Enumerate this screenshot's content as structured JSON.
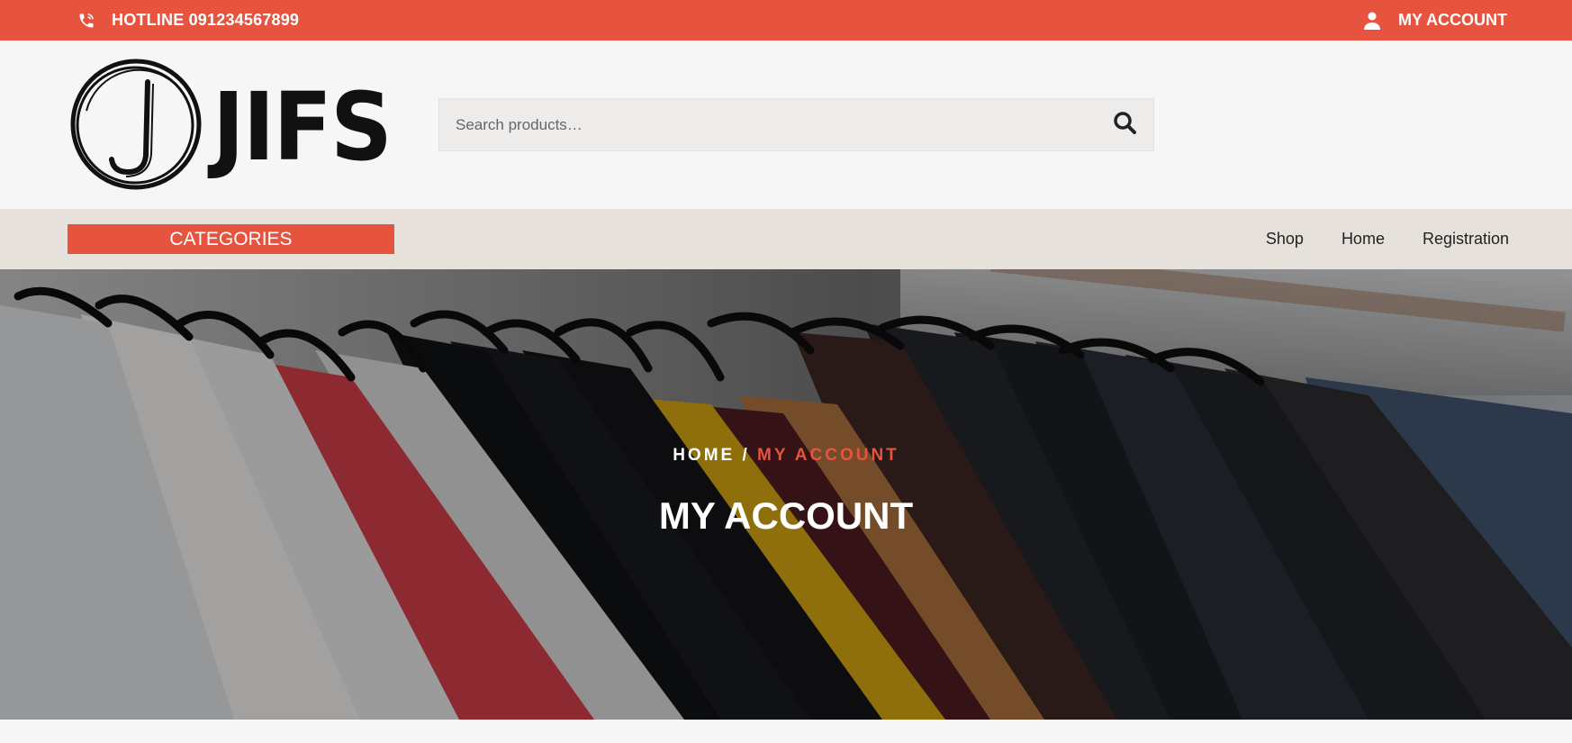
{
  "topbar": {
    "hotline": "HOTLINE 091234567899",
    "account": "MY ACCOUNT",
    "phone_icon": "phone-icon",
    "user_icon": "user-icon"
  },
  "header": {
    "logo_text": "JIFS",
    "search": {
      "placeholder": "Search products…",
      "value": ""
    }
  },
  "nav": {
    "categories": "CATEGORIES",
    "links": [
      "Shop",
      "Home",
      "Registration"
    ]
  },
  "hero": {
    "breadcrumb_home": "HOME",
    "breadcrumb_sep": "/",
    "breadcrumb_current": "MY ACCOUNT",
    "title": "MY ACCOUNT"
  },
  "colors": {
    "accent": "#e6533e",
    "nav_bg": "#e6e1da",
    "header_bg": "#f6f6f6"
  }
}
